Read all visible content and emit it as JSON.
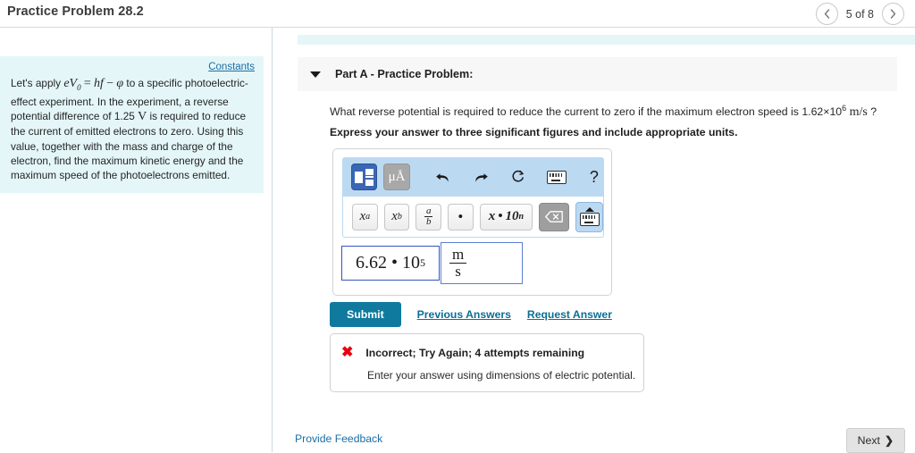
{
  "header": {
    "title": "Practice Problem 28.2",
    "prev_icon": "chevron-left-icon",
    "next_icon": "chevron-right-icon",
    "page_counter": "5 of 8"
  },
  "sidebar": {
    "constants_link": "Constants",
    "problem_html": "Let's apply <span class=\"mathi\">eV<sub>0</sub></span> <span class=\"mathu\">=</span> <span class=\"mathi\">hf</span> <span class=\"mathu\">&minus;</span> <span class=\"mathi\">&phi;</span> to a specific photoelectric-effect experiment. In the experiment, a reverse potential difference of 1.25 <span class=\"mathu\">V</span> is required to reduce the current of emitted electrons to zero. Using this value, together with the mass and charge of the electron, find the maximum kinetic energy and the maximum speed of the photoelectrons emitted."
  },
  "part_a": {
    "collapse_icon": "caret-down-icon",
    "title": "Part A - Practice Problem:",
    "question_html": "What reverse potential is required to reduce the current to zero if the maximum electron speed is 1.62&times;10<sup>6</sup> <span class=\"mathu\">m/s</span> ?",
    "instruction": "Express your answer to three significant figures and include appropriate units."
  },
  "answer_widget": {
    "toolbar_top": [
      {
        "name": "template-button",
        "icon": "template-layout-icon",
        "label": ""
      },
      {
        "name": "units-button",
        "icon": "micro-angstrom-icon",
        "label": "μÅ"
      },
      {
        "name": "undo-button",
        "icon": "undo-arrow-icon",
        "label": ""
      },
      {
        "name": "redo-button",
        "icon": "redo-arrow-icon",
        "label": ""
      },
      {
        "name": "reset-button",
        "icon": "reset-circular-arrow-icon",
        "label": ""
      },
      {
        "name": "keyboard-button",
        "icon": "keyboard-icon",
        "label": ""
      },
      {
        "name": "help-button",
        "icon": "question-mark-icon",
        "label": "?"
      }
    ],
    "toolbar_bottom": [
      {
        "name": "superscript-button",
        "label": "x",
        "sup": "a"
      },
      {
        "name": "subscript-button",
        "label": "x",
        "sub": "b"
      },
      {
        "name": "fraction-button",
        "numerator": "a",
        "denominator": "b"
      },
      {
        "name": "multiply-dot-button",
        "label": "•"
      },
      {
        "name": "scientific-notation-button",
        "label": "x • 10",
        "sup": "n"
      },
      {
        "name": "backspace-button",
        "icon": "backspace-icon"
      },
      {
        "name": "keyboard-toggle-button",
        "icon": "keyboard-up-icon"
      }
    ],
    "answer_value_html": "6.62 &bull; 10<sup>5</sup>",
    "unit_numerator": "m",
    "unit_denominator": "s"
  },
  "actions": {
    "submit_label": "Submit",
    "previous_answers_label": "Previous Answers",
    "request_answer_label": "Request Answer"
  },
  "feedback": {
    "status_icon": "red-x-icon",
    "title": "Incorrect; Try Again; 4 attempts remaining",
    "detail": "Enter your answer using dimensions of electric potential."
  },
  "footer": {
    "provide_feedback_label": "Provide Feedback",
    "next_label": "Next",
    "next_icon": "chevron-right-icon"
  },
  "colors": {
    "accent_teal": "#0f7a9e",
    "link_blue": "#1b6ea5",
    "panel_cyan": "#e4f6f8",
    "toolbar_blue": "#bcd9f2",
    "error_red": "#e8000f"
  }
}
